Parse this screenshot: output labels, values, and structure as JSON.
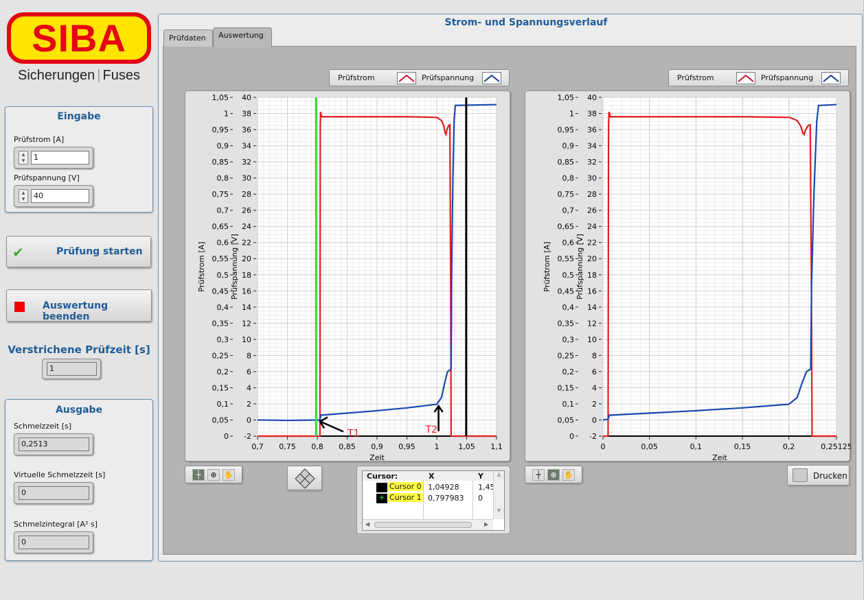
{
  "logo": {
    "brand": "SIBA",
    "tagline_left": "Sicherungen",
    "tagline_right": "Fuses",
    "colors": {
      "red": "#e30613",
      "yellow": "#ffe500"
    }
  },
  "eingabe": {
    "title": "Eingabe",
    "pruefstrom_label": "Prüfstrom [A]",
    "pruefstrom_value": "1",
    "pruefspannung_label": "Prüfspannung [V]",
    "pruefspannung_value": "40"
  },
  "buttons": {
    "start": "Prüfung starten",
    "stop": "Auswertung beenden"
  },
  "elapsed": {
    "label": "Verstrichene Prüfzeit [s]",
    "value": "1"
  },
  "ausgabe": {
    "title": "Ausgabe",
    "schmelzzeit_label": "Schmelzzeit [s]",
    "schmelzzeit_value": "0,2513",
    "virtuell_label": "Virtuelle Schmelzzeit [s]",
    "virtuell_value": "0",
    "integral_label": "Schmelzintegral [A² s]",
    "integral_value": "0"
  },
  "main": {
    "title": "Strom- und Spannungsverlauf",
    "tabs": [
      {
        "label": "Prüfdaten",
        "active": false
      },
      {
        "label": "Auswertung",
        "active": true
      }
    ]
  },
  "legend": {
    "current": "Prüfstrom",
    "voltage": "Prüfspannung"
  },
  "cursor_table": {
    "header": [
      "Cursor:",
      "X",
      "Y"
    ],
    "rows": [
      {
        "name": "Cursor 0",
        "x": "1,04928",
        "y": "1,45"
      },
      {
        "name": "Cursor 1",
        "x": "0,797983",
        "y": "0"
      }
    ]
  },
  "print_button": "Drucken",
  "chart_data": [
    {
      "type": "line",
      "name": "evaluation-chart",
      "xlabel": "Zeit",
      "ylabel_left": "Prüfstrom [A]",
      "ylabel_right": "Prüfspannung [V]",
      "xlim": [
        0.7,
        1.1
      ],
      "ylim_current": [
        0,
        1.05
      ],
      "ylim_voltage": [
        -2,
        40
      ],
      "x_ticks": [
        "0,7",
        "0,75",
        "0,8",
        "0,85",
        "0,9",
        "0,95",
        "1",
        "1,05",
        "1,1"
      ],
      "x_tick_values": [
        0.7,
        0.75,
        0.8,
        0.85,
        0.9,
        0.95,
        1.0,
        1.05,
        1.1
      ],
      "y_ticks_current": [
        "0",
        "0,05",
        "0,1",
        "0,15",
        "0,2",
        "0,25",
        "0,3",
        "0,35",
        "0,4",
        "0,45",
        "0,5",
        "0,55",
        "0,6",
        "0,65",
        "0,7",
        "0,75",
        "0,8",
        "0,85",
        "0,9",
        "0,95",
        "1",
        "1,05"
      ],
      "y_ticks_voltage": [
        "-2",
        "0",
        "2",
        "4",
        "6",
        "8",
        "10",
        "12",
        "14",
        "16",
        "18",
        "20",
        "22",
        "24",
        "26",
        "28",
        "30",
        "32",
        "34",
        "36",
        "38",
        "40"
      ],
      "grid": true,
      "series": [
        {
          "name": "Prüfstrom",
          "color": "#e31c1c",
          "axis": "current",
          "points": [
            [
              0.7,
              0
            ],
            [
              0.8045,
              0
            ],
            [
              0.805,
              0.96
            ],
            [
              0.8055,
              1.005
            ],
            [
              0.807,
              0.99
            ],
            [
              0.95,
              0.99
            ],
            [
              1.0,
              0.988
            ],
            [
              1.008,
              0.978
            ],
            [
              1.012,
              0.96
            ],
            [
              1.014,
              0.94
            ],
            [
              1.0155,
              0.935
            ],
            [
              1.017,
              0.95
            ],
            [
              1.02,
              0.963
            ],
            [
              1.022,
              0.965
            ],
            [
              1.0232,
              0.5
            ],
            [
              1.024,
              0
            ],
            [
              1.1,
              0
            ]
          ]
        },
        {
          "name": "Prüfspannung",
          "color": "#1a46b0",
          "axis": "voltage",
          "points": [
            [
              0.7,
              0
            ],
            [
              0.75,
              -0.05
            ],
            [
              0.8045,
              0
            ],
            [
              0.806,
              0.6
            ],
            [
              0.85,
              0.85
            ],
            [
              0.9,
              1.15
            ],
            [
              0.95,
              1.5
            ],
            [
              1.0,
              1.95
            ],
            [
              1.008,
              2.8
            ],
            [
              1.013,
              4.5
            ],
            [
              1.018,
              6
            ],
            [
              1.024,
              6.3
            ],
            [
              1.025,
              19
            ],
            [
              1.027,
              30
            ],
            [
              1.029,
              37
            ],
            [
              1.031,
              39
            ],
            [
              1.1,
              39.1
            ]
          ]
        }
      ],
      "cursors": [
        {
          "name": "Cursor 0",
          "x": 1.04928,
          "color": "#000000"
        },
        {
          "name": "Cursor 1",
          "x": 0.797983,
          "color": "#33dd33"
        }
      ],
      "annotations": [
        {
          "text": "T1",
          "x": 0.8,
          "y_voltage": 0
        },
        {
          "text": "T2",
          "x": 1.003,
          "y_voltage": 2
        }
      ]
    },
    {
      "type": "line",
      "name": "full-chart",
      "xlabel": "Zeit",
      "ylabel_left": "Prüfstrom [A]",
      "ylabel_right": "Prüfspannung [V]",
      "xlim": [
        0,
        0.25125
      ],
      "ylim_current": [
        0,
        1.05
      ],
      "ylim_voltage": [
        -2,
        40
      ],
      "x_ticks": [
        "0",
        "0,05",
        "0,1",
        "0,15",
        "0,2",
        "0,25125"
      ],
      "x_tick_values": [
        0,
        0.05,
        0.1,
        0.15,
        0.2,
        0.25125
      ],
      "y_ticks_current": [
        "0",
        "0,05",
        "0,1",
        "0,15",
        "0,2",
        "0,25",
        "0,3",
        "0,35",
        "0,4",
        "0,45",
        "0,5",
        "0,55",
        "0,6",
        "0,65",
        "0,7",
        "0,75",
        "0,8",
        "0,85",
        "0,9",
        "0,95",
        "1",
        "1,05"
      ],
      "y_ticks_voltage": [
        "-2",
        "0",
        "2",
        "4",
        "6",
        "8",
        "10",
        "12",
        "14",
        "16",
        "18",
        "20",
        "22",
        "24",
        "26",
        "28",
        "30",
        "32",
        "34",
        "36",
        "38",
        "40"
      ],
      "grid": true,
      "series": [
        {
          "name": "Prüfstrom",
          "color": "#e31c1c",
          "axis": "current",
          "points": [
            [
              0,
              0
            ],
            [
              0.0055,
              0
            ],
            [
              0.006,
              0.96
            ],
            [
              0.0065,
              1.005
            ],
            [
              0.008,
              0.99
            ],
            [
              0.15,
              0.99
            ],
            [
              0.201,
              0.988
            ],
            [
              0.209,
              0.978
            ],
            [
              0.213,
              0.96
            ],
            [
              0.215,
              0.94
            ],
            [
              0.2165,
              0.935
            ],
            [
              0.218,
              0.95
            ],
            [
              0.221,
              0.963
            ],
            [
              0.223,
              0.965
            ],
            [
              0.2242,
              0.5
            ],
            [
              0.225,
              0
            ],
            [
              0.25125,
              0
            ]
          ]
        },
        {
          "name": "Prüfspannung",
          "color": "#1a46b0",
          "axis": "voltage",
          "points": [
            [
              0,
              0
            ],
            [
              0.0055,
              0.1
            ],
            [
              0.007,
              0.6
            ],
            [
              0.05,
              0.85
            ],
            [
              0.1,
              1.15
            ],
            [
              0.15,
              1.5
            ],
            [
              0.2,
              1.95
            ],
            [
              0.209,
              2.8
            ],
            [
              0.214,
              4.5
            ],
            [
              0.219,
              6
            ],
            [
              0.2235,
              6.3
            ],
            [
              0.2245,
              17
            ],
            [
              0.227,
              28
            ],
            [
              0.23,
              37
            ],
            [
              0.232,
              39
            ],
            [
              0.25125,
              39.1
            ]
          ]
        }
      ]
    }
  ]
}
